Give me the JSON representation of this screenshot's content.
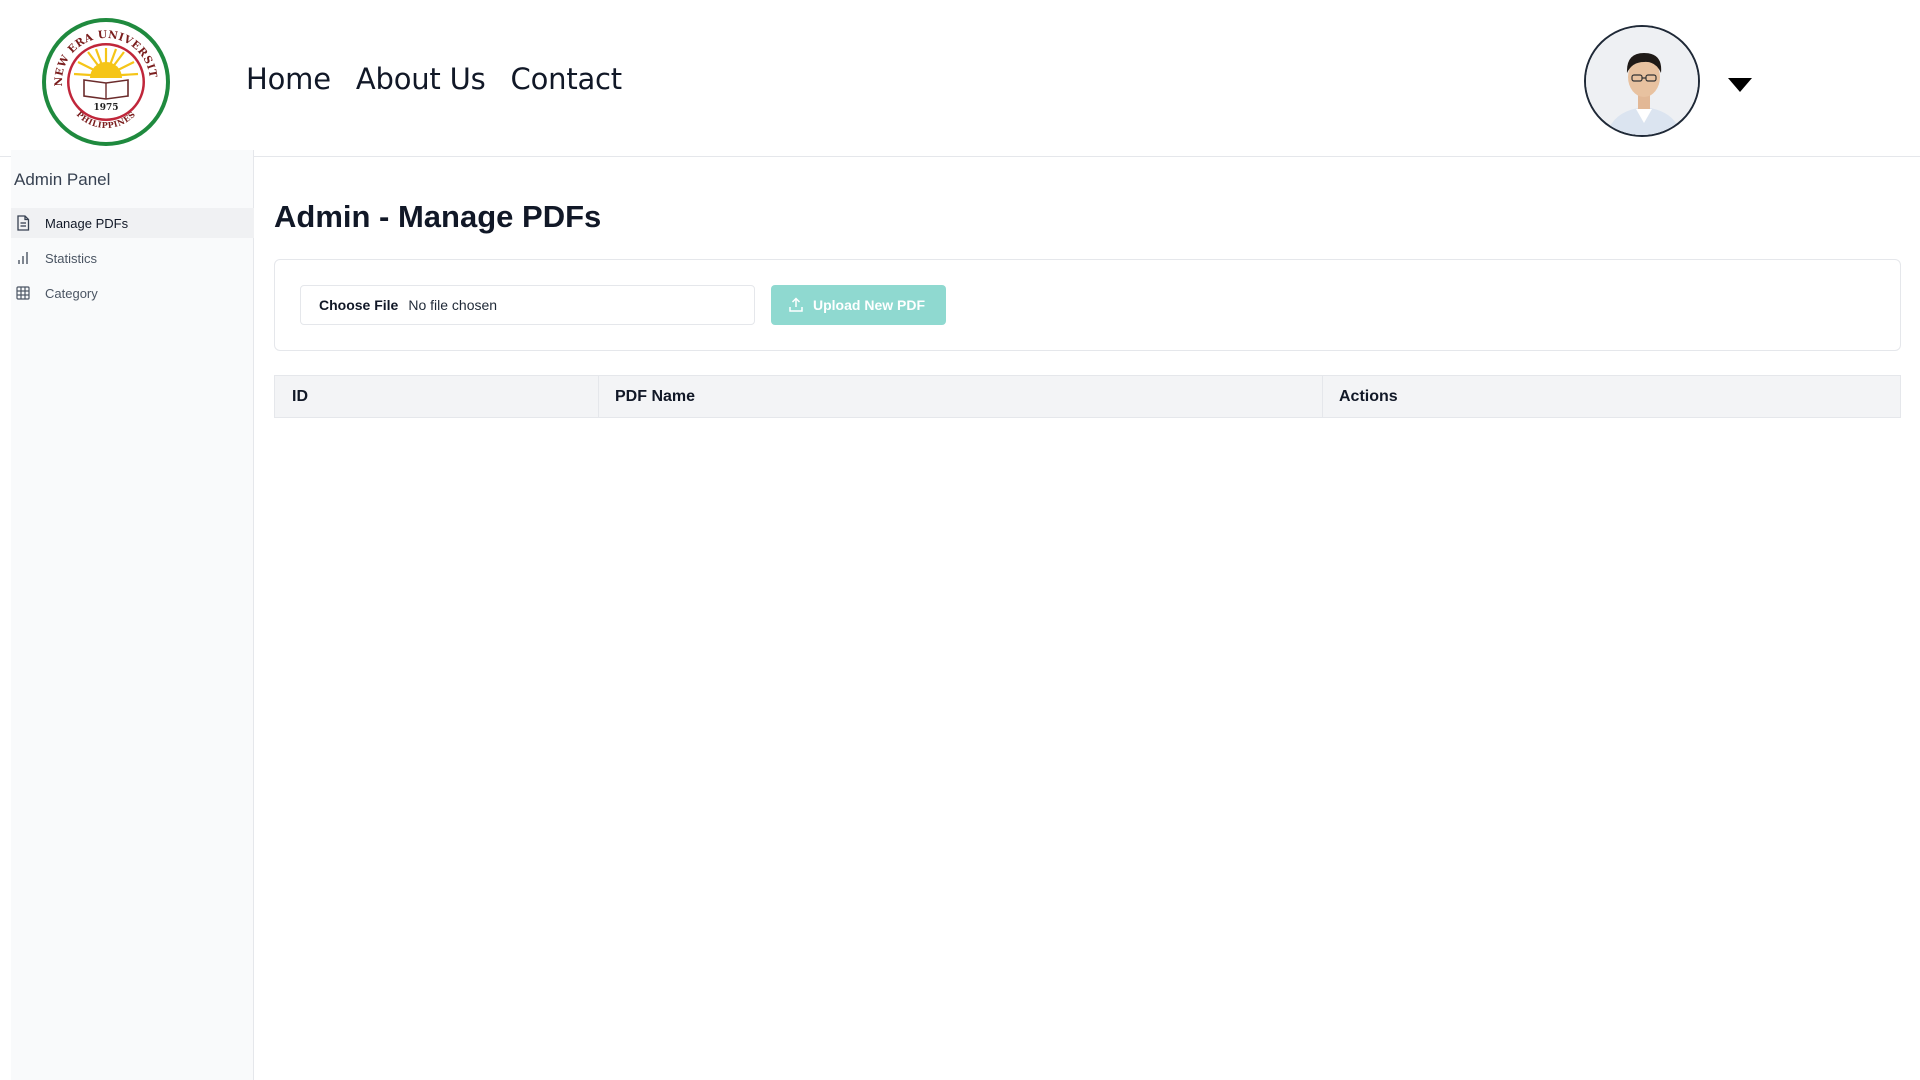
{
  "header": {
    "logo": {
      "ring_text_top": "NEW ERA UNIVERSITY",
      "ring_text_bottom": "PHILIPPINES",
      "year": "1975"
    },
    "nav": [
      {
        "label": "Home"
      },
      {
        "label": "About Us"
      },
      {
        "label": "Contact"
      }
    ],
    "avatar_icon": "user-avatar",
    "menu_icon": "caret-down-icon"
  },
  "sidebar": {
    "title": "Admin Panel",
    "items": [
      {
        "label": "Manage PDFs",
        "icon": "document-icon",
        "active": true
      },
      {
        "label": "Statistics",
        "icon": "bar-chart-icon",
        "active": false
      },
      {
        "label": "Category",
        "icon": "grid-icon",
        "active": false
      }
    ]
  },
  "main": {
    "title": "Admin - Manage PDFs",
    "file_input": {
      "button_label": "Choose File",
      "status": "No file chosen"
    },
    "upload_button": {
      "label": "Upload New PDF",
      "icon": "upload-icon"
    },
    "table": {
      "columns": [
        "ID",
        "PDF Name",
        "Actions"
      ],
      "rows": []
    }
  },
  "colors": {
    "upload_button": "#8fd9d0",
    "logo_green": "#1f8a3e",
    "logo_red": "#c0263a",
    "logo_sun": "#f5c518"
  }
}
